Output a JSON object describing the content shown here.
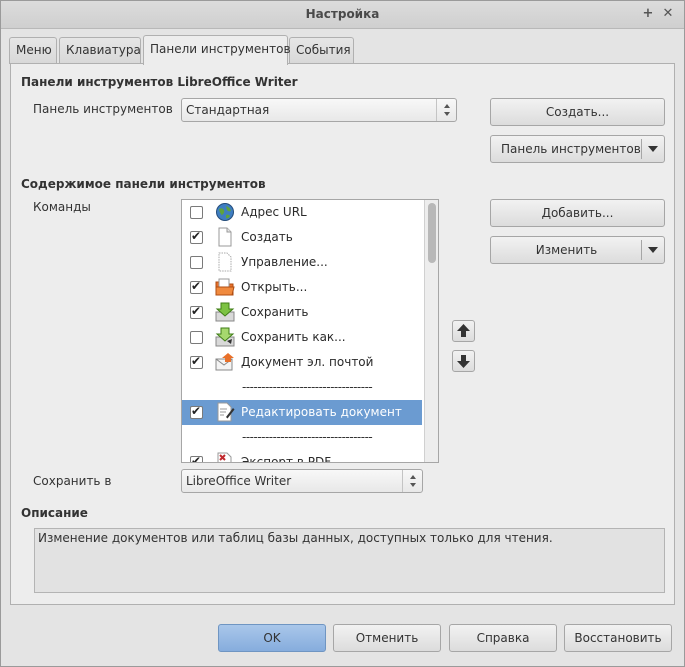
{
  "window": {
    "title": "Настройка"
  },
  "tabs": [
    {
      "label": "Меню"
    },
    {
      "label": "Клавиатура"
    },
    {
      "label": "Панели инструментов"
    },
    {
      "label": "События"
    }
  ],
  "toolbars_section": {
    "title": "Панели инструментов LibreOffice Writer",
    "toolbar_label": "Панель инструментов",
    "toolbar_value": "Стандартная",
    "create_button": "Создать...",
    "toolbar_menu_button": "Панель инструментов"
  },
  "contents_section": {
    "title": "Содержимое панели инструментов",
    "commands_label": "Команды",
    "items": [
      {
        "label": "Адрес URL",
        "checked": false,
        "icon": "globe-icon"
      },
      {
        "label": "Создать",
        "checked": true,
        "icon": "new-document-icon"
      },
      {
        "label": "Управление...",
        "checked": false,
        "icon": "templates-icon"
      },
      {
        "label": "Открыть...",
        "checked": true,
        "icon": "open-folder-icon"
      },
      {
        "label": "Сохранить",
        "checked": true,
        "icon": "save-icon"
      },
      {
        "label": "Сохранить как...",
        "checked": false,
        "icon": "save-as-icon"
      },
      {
        "label": "Документ эл. почтой",
        "checked": true,
        "icon": "email-icon"
      },
      {
        "separator": "----------------------------------"
      },
      {
        "label": "Редактировать документ",
        "checked": true,
        "icon": "edit-document-icon",
        "selected": true
      },
      {
        "separator": "----------------------------------"
      },
      {
        "label": "Экспорт в PDF",
        "checked": true,
        "icon": "pdf-icon"
      }
    ],
    "add_button": "Добавить...",
    "modify_button": "Изменить"
  },
  "save_in": {
    "label": "Сохранить в",
    "value": "LibreOffice Writer"
  },
  "description": {
    "title": "Описание",
    "text": "Изменение документов или таблиц базы данных, доступных только для чтения."
  },
  "footer": {
    "ok": "OK",
    "cancel": "Отменить",
    "help": "Справка",
    "reset": "Восстановить"
  },
  "colors": {
    "selection": "#6b9bd1",
    "ok_button": "#94b8e3"
  }
}
